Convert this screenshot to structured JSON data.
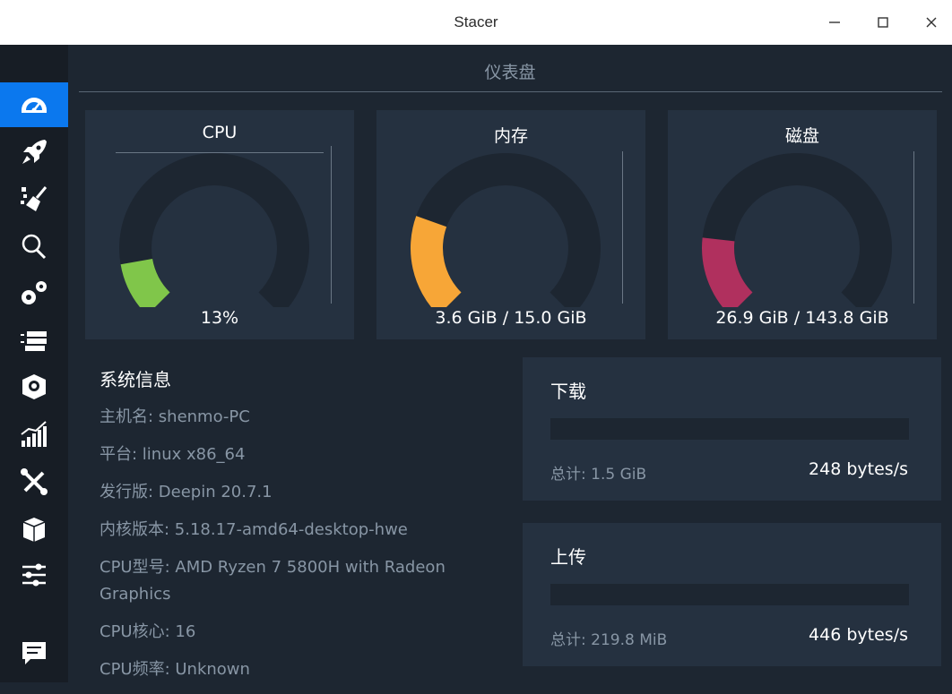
{
  "window": {
    "title": "Stacer"
  },
  "page": {
    "title": "仪表盘"
  },
  "gauges": [
    {
      "title": "CPU",
      "value_text": "13%",
      "fraction": 0.13,
      "color": "#80c64a"
    },
    {
      "title": "内存",
      "value_text": "3.6 GiB / 15.0 GiB",
      "fraction": 0.24,
      "color": "#f7a637"
    },
    {
      "title": "磁盘",
      "value_text": "26.9 GiB / 143.8 GiB",
      "fraction": 0.19,
      "color": "#b0305e"
    }
  ],
  "sysinfo": {
    "title": "系统信息",
    "hostname": "主机名: shenmo-PC",
    "platform": "平台: linux x86_64",
    "distro": "发行版: Deepin 20.7.1",
    "kernel": "内核版本: 5.18.17-amd64-desktop-hwe",
    "cpu_model": "CPU型号:  AMD Ryzen 7 5800H with Radeon Graphics",
    "cpu_cores": "CPU核心: 16",
    "cpu_freq": "CPU频率: Unknown"
  },
  "download": {
    "title": "下载",
    "total": "总计: 1.5 GiB",
    "speed": "248 bytes/s"
  },
  "upload": {
    "title": "上传",
    "total": "总计: 219.8 MiB",
    "speed": "446 bytes/s"
  },
  "sidebar": {
    "items": [
      {
        "icon": "dashboard-icon"
      },
      {
        "icon": "rocket-icon"
      },
      {
        "icon": "broom-icon"
      },
      {
        "icon": "search-icon"
      },
      {
        "icon": "gears-icon"
      },
      {
        "icon": "processes-icon"
      },
      {
        "icon": "uninstaller-icon"
      },
      {
        "icon": "resources-chart-icon"
      },
      {
        "icon": "tools-icon"
      },
      {
        "icon": "box-icon"
      },
      {
        "icon": "sliders-icon"
      },
      {
        "icon": "feedback-icon"
      }
    ]
  },
  "colors": {
    "accent": "#0b78ee",
    "card": "#253140",
    "background": "#1d2631",
    "sidebar": "#171d25"
  }
}
